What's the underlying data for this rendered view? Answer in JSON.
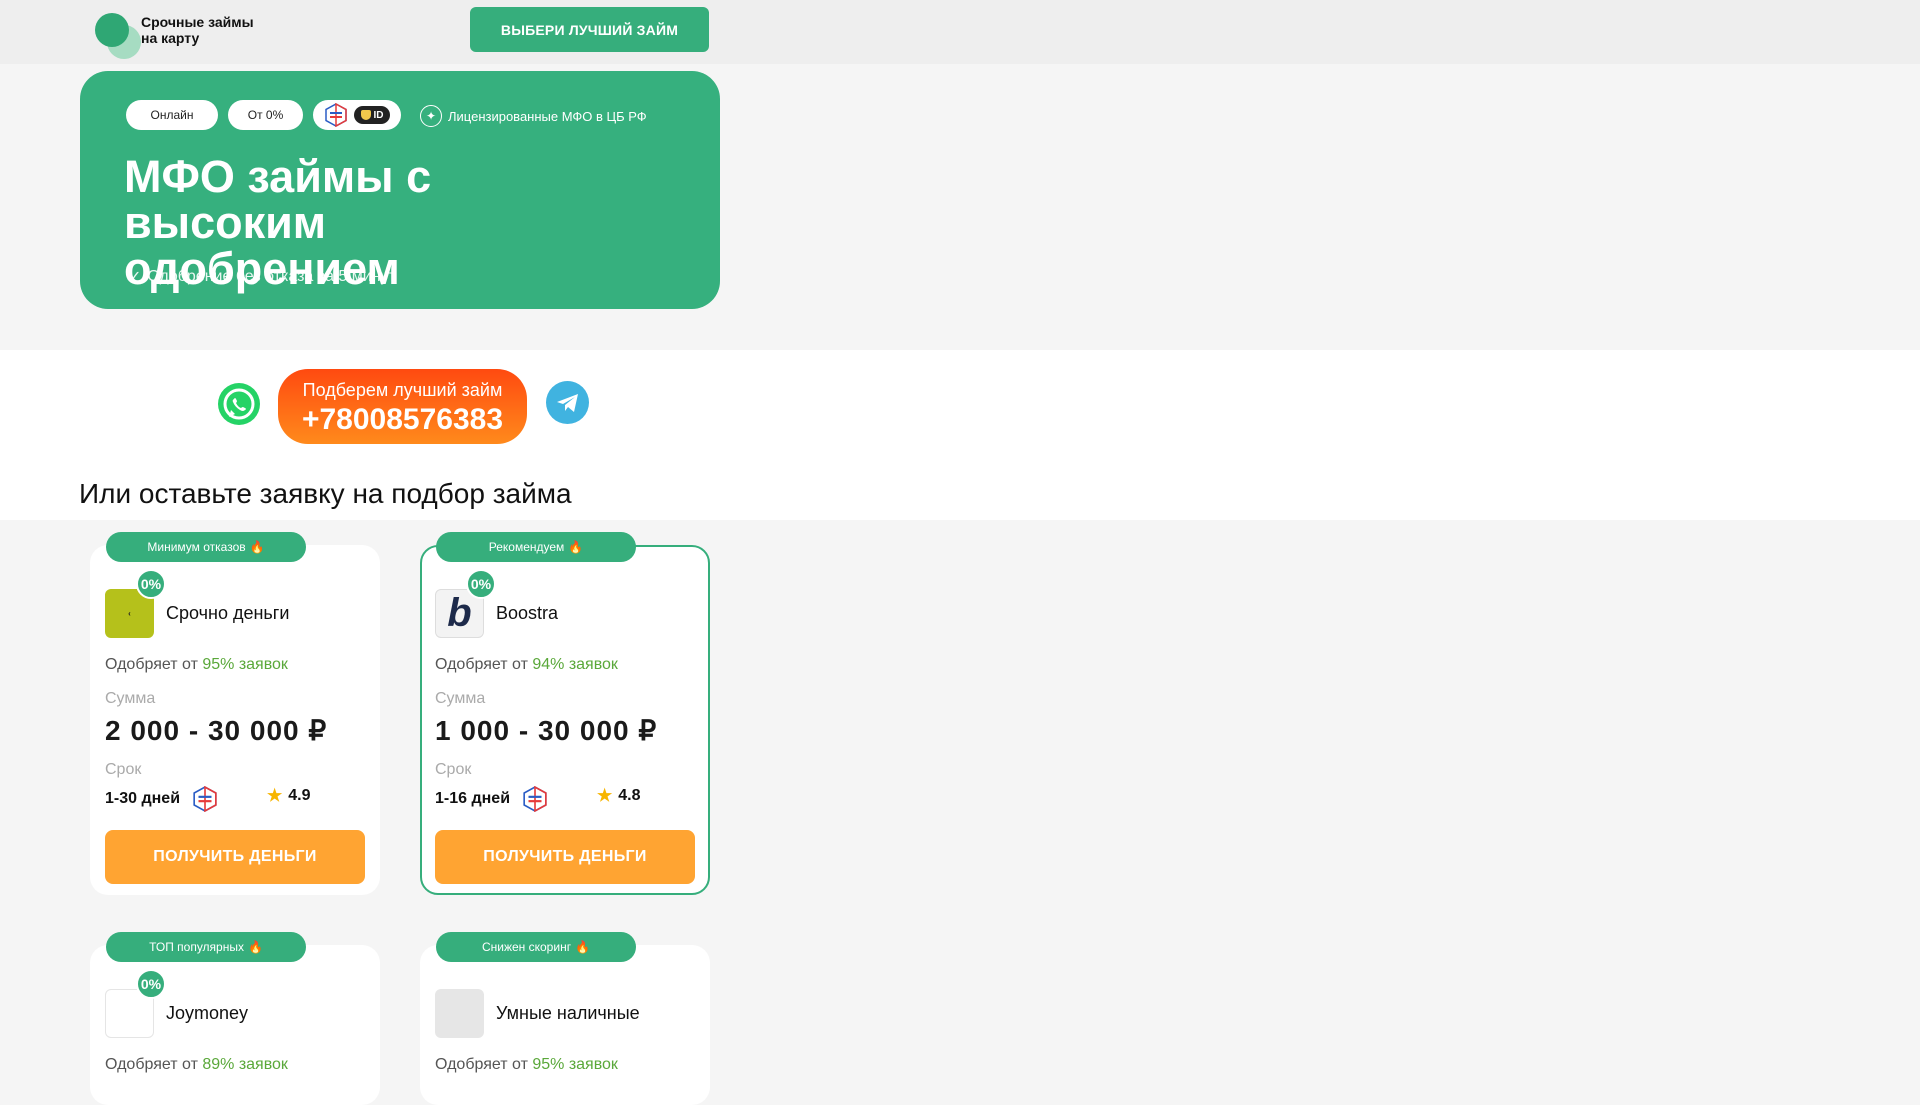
{
  "header": {
    "logo_text_line1": "Срочные займы",
    "logo_text_line2": "на карту",
    "cta_label": "ВЫБЕРИ ЛУЧШИЙ ЗАЙМ"
  },
  "hero": {
    "pill_online": "Онлайн",
    "pill_zero": "От 0%",
    "id_label": "ID",
    "license_text": "Лицензированные МФО в ЦБ РФ",
    "title": "МФО займы с высоким одобрением",
    "subtitle": "Одобрение без отказа за 5 минут"
  },
  "contact": {
    "phone_caption": "Подберем лучший займ",
    "phone_number": "+78008576383"
  },
  "section_title": "Или оставьте заявку на подбор займа",
  "colors": {
    "accent": "#36ae7c",
    "orange": "#ffa432",
    "approve_green": "#5aa83a"
  },
  "offers": [
    {
      "tag": "Минимум отказов",
      "name": "Срочно деньги",
      "zero_badge": "0%",
      "approve_prefix": "Одобряет от",
      "approve_value": "95% заявок",
      "sum_label": "Сумма",
      "amount": "2 000 - 30 000 ₽",
      "term_label": "Срок",
      "term": "1-30 дней",
      "rating": "4.9",
      "button": "ПОЛУЧИТЬ ДЕНЬГИ"
    },
    {
      "tag": "Рекомендуем",
      "name": "Boostra",
      "zero_badge": "0%",
      "approve_prefix": "Одобряет от",
      "approve_value": "94% заявок",
      "sum_label": "Сумма",
      "amount": "1 000 - 30 000 ₽",
      "term_label": "Срок",
      "term": "1-16 дней",
      "rating": "4.8",
      "button": "ПОЛУЧИТЬ ДЕНЬГИ"
    },
    {
      "tag": "ТОП популярных",
      "name": "Joymoney",
      "zero_badge": "0%",
      "approve_prefix": "Одобряет от",
      "approve_value": "89% заявок"
    },
    {
      "tag": "Снижен скоринг",
      "name": "Умные наличные",
      "approve_prefix": "Одобряет от",
      "approve_value": "95% заявок"
    }
  ],
  "icons": [
    "whatsapp-icon",
    "telegram-icon",
    "fire-icon",
    "star-icon",
    "gosuslugi-icon",
    "eagle-icon",
    "check-icon"
  ]
}
